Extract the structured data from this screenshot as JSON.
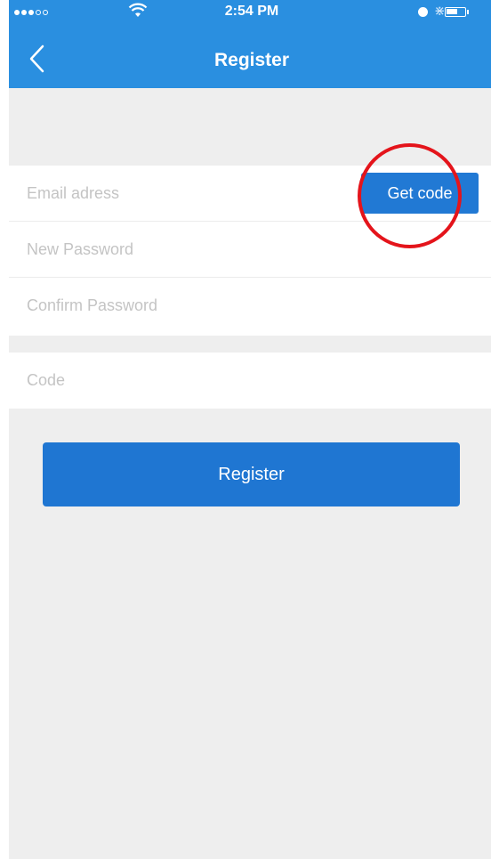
{
  "status_bar": {
    "time": "2:54 PM"
  },
  "nav": {
    "title": "Register",
    "back_icon": "chevron-left-icon"
  },
  "form": {
    "email": {
      "placeholder": "Email adress",
      "value": ""
    },
    "get_code_label": "Get code",
    "new_password": {
      "placeholder": "New Password",
      "value": ""
    },
    "confirm_password": {
      "placeholder": "Confirm Password",
      "value": ""
    },
    "code": {
      "placeholder": "Code",
      "value": ""
    }
  },
  "register_label": "Register",
  "colors": {
    "header": "#2a8fe0",
    "button": "#1f76d2",
    "highlight": "#e4141b",
    "background": "#eeeeee"
  }
}
